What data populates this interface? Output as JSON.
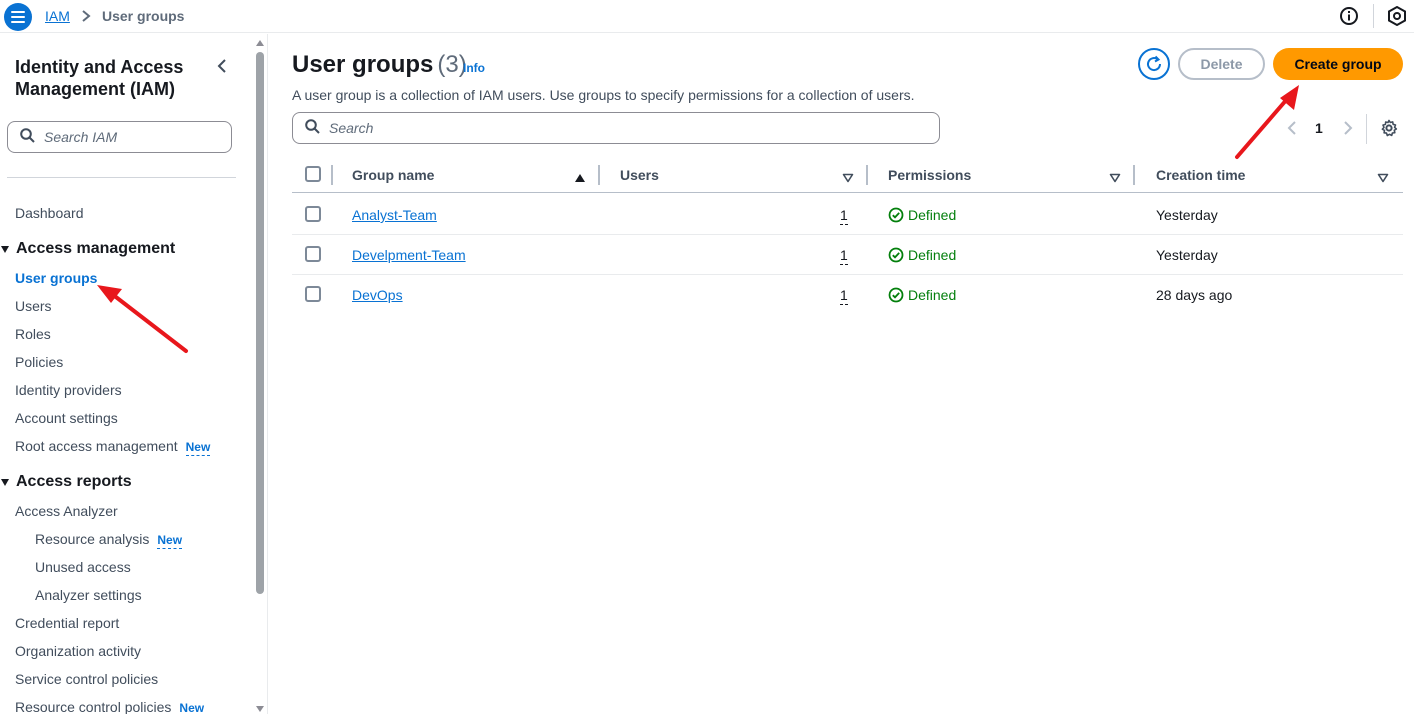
{
  "topbar": {
    "breadcrumb_root": "IAM",
    "breadcrumb_current": "User groups"
  },
  "sidebar": {
    "title": "Identity and Access Management (IAM)",
    "search_placeholder": "Search IAM",
    "dashboard": "Dashboard",
    "access_management": {
      "label": "Access management",
      "items": [
        "User groups",
        "Users",
        "Roles",
        "Policies",
        "Identity providers",
        "Account settings",
        "Root access management"
      ]
    },
    "access_reports": {
      "label": "Access reports",
      "items": [
        "Access Analyzer",
        "Resource analysis",
        "Unused access",
        "Analyzer settings",
        "Credential report",
        "Organization activity",
        "Service control policies",
        "Resource control policies"
      ]
    },
    "new_badge": "New"
  },
  "main": {
    "title": "User groups",
    "count": "(3)",
    "info": "Info",
    "description": "A user group is a collection of IAM users. Use groups to specify permissions for a collection of users.",
    "search_placeholder": "Search",
    "buttons": {
      "delete": "Delete",
      "create": "Create group"
    },
    "pagination": {
      "page": "1"
    },
    "table": {
      "columns": [
        "Group name",
        "Users",
        "Permissions",
        "Creation time"
      ],
      "rows": [
        {
          "name": "Analyst-Team",
          "users": "1",
          "permissions": "Defined",
          "created": "Yesterday"
        },
        {
          "name": "Develpment-Team",
          "users": "1",
          "permissions": "Defined",
          "created": "Yesterday"
        },
        {
          "name": "DevOps",
          "users": "1",
          "permissions": "Defined",
          "created": "28 days ago"
        }
      ]
    }
  },
  "colors": {
    "link": "#0972d3",
    "primary_button": "#ff9900",
    "success": "#037f0c",
    "annotation_arrow": "#e8171c"
  },
  "icons": [
    "menu-icon",
    "chevron-right-icon",
    "info-circle-icon",
    "hexagon-icon",
    "chevron-left-icon",
    "search-icon",
    "refresh-icon",
    "settings-icon",
    "sort-ascending-icon",
    "sort-descending-icon",
    "check-circle-icon"
  ]
}
